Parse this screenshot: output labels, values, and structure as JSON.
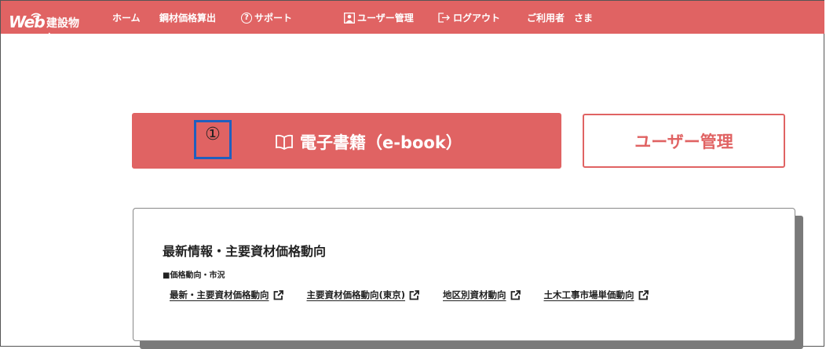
{
  "header": {
    "logo_prefix": "Web",
    "logo_name": "建設物価",
    "nav": {
      "home": "ホーム",
      "price_calc": "鋼材価格算出",
      "support": "サポート",
      "user_management": "ユーザー管理",
      "logout": "ログアウト",
      "user_greeting": "ご利用者　さま"
    }
  },
  "main": {
    "ebook_button": "電子書籍（e-book）",
    "marker_label": "①",
    "user_management_button": "ユーザー管理"
  },
  "info_card": {
    "title": "最新情報・主要資材価格動向",
    "subtitle": "■価格動向・市況",
    "links": [
      "最新・主要資材価格動向",
      "主要資材価格動向(東京)",
      "地区別資材動向",
      "土木工事市場単価動向"
    ]
  },
  "colors": {
    "brand": "#e06363",
    "marker_border": "#1f5fbf"
  },
  "icons": [
    "wifi-icon",
    "question-circle-icon",
    "user-icon",
    "logout-icon",
    "book-open-icon",
    "external-link-icon"
  ]
}
